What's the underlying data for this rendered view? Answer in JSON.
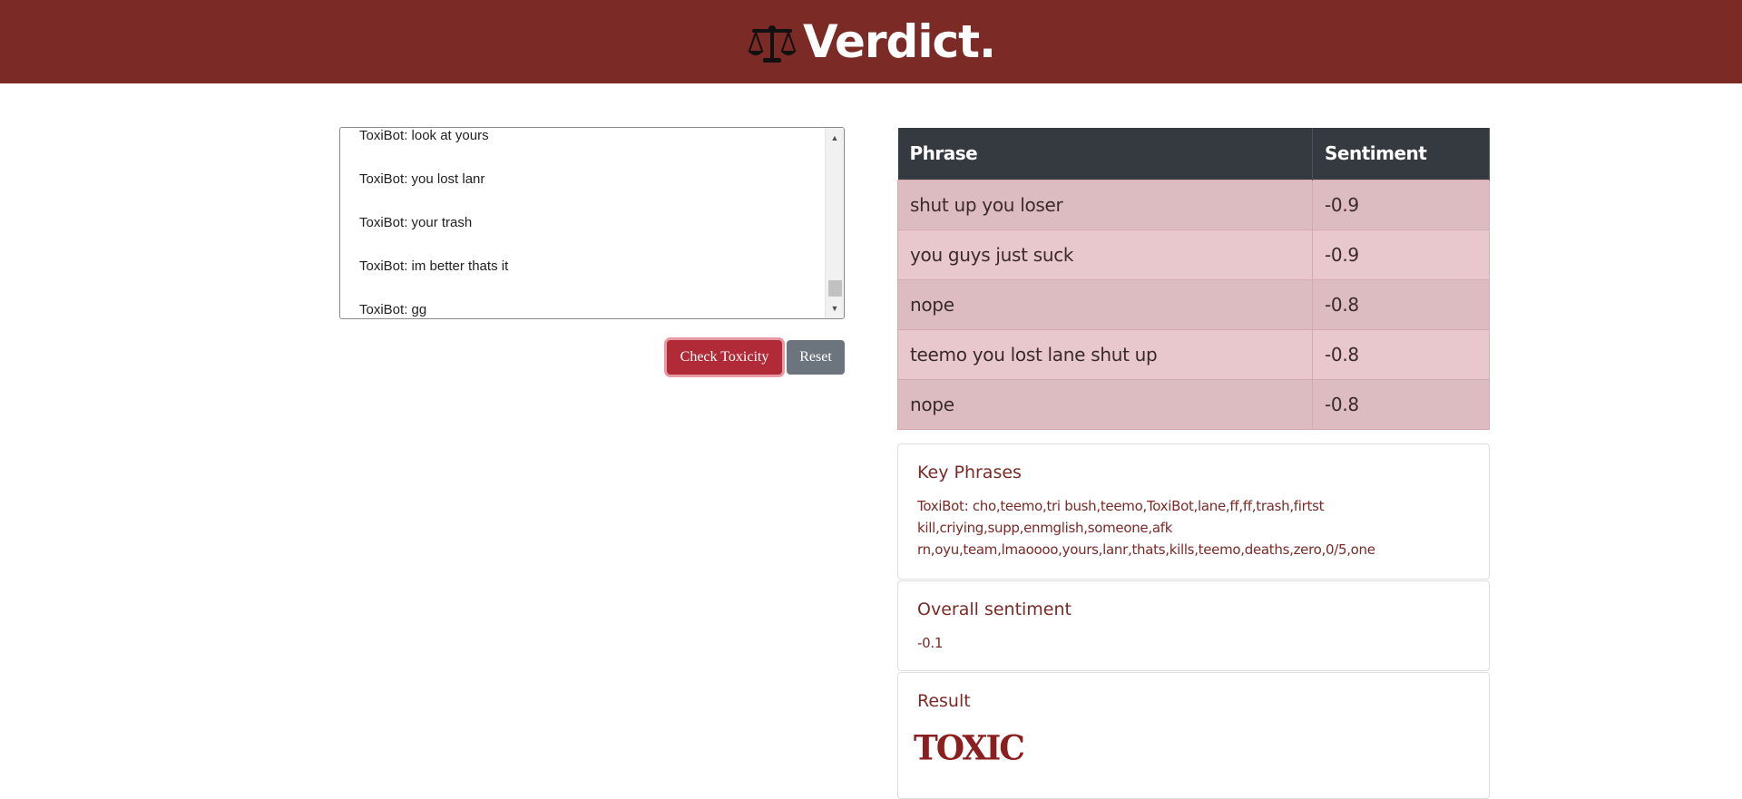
{
  "header": {
    "title": "Verdict."
  },
  "chat": {
    "lines": [
      "ToxiBot: look at yours",
      "ToxiBot: you lost lanr",
      "ToxiBot: your trash",
      "ToxiBot: im better thats it",
      "ToxiBot: gg"
    ]
  },
  "actions": {
    "check_label": "Check Toxicity",
    "reset_label": "Reset"
  },
  "table": {
    "headers": [
      "Phrase",
      "Sentiment"
    ],
    "rows": [
      {
        "phrase": "shut up you loser",
        "sentiment": "-0.9"
      },
      {
        "phrase": "you guys just suck",
        "sentiment": "-0.9"
      },
      {
        "phrase": "nope",
        "sentiment": "-0.8"
      },
      {
        "phrase": "teemo you lost lane shut up",
        "sentiment": "-0.8"
      },
      {
        "phrase": "nope",
        "sentiment": "-0.8"
      }
    ]
  },
  "key_phrases": {
    "title": "Key Phrases",
    "line1": "ToxiBot: cho,teemo,tri bush,teemo,ToxiBot,lane,ff,ff,trash,firtst",
    "line2": "kill,criying,supp,enmglish,someone,afk",
    "line3": "rn,oyu,team,lmaoooo,yours,lanr,thats,kills,teemo,deaths,zero,0/5,one"
  },
  "overall": {
    "title": "Overall sentiment",
    "value": "-0.1"
  },
  "result": {
    "title": "Result",
    "value": "TOXIC"
  },
  "colors": {
    "header_bg": "#7b2a26",
    "table_head_bg": "#343a40",
    "row_odd": "#dcbcc1",
    "row_even": "#e8c8cc",
    "check_button": "#b02a37",
    "reset_button": "#6c757d"
  }
}
